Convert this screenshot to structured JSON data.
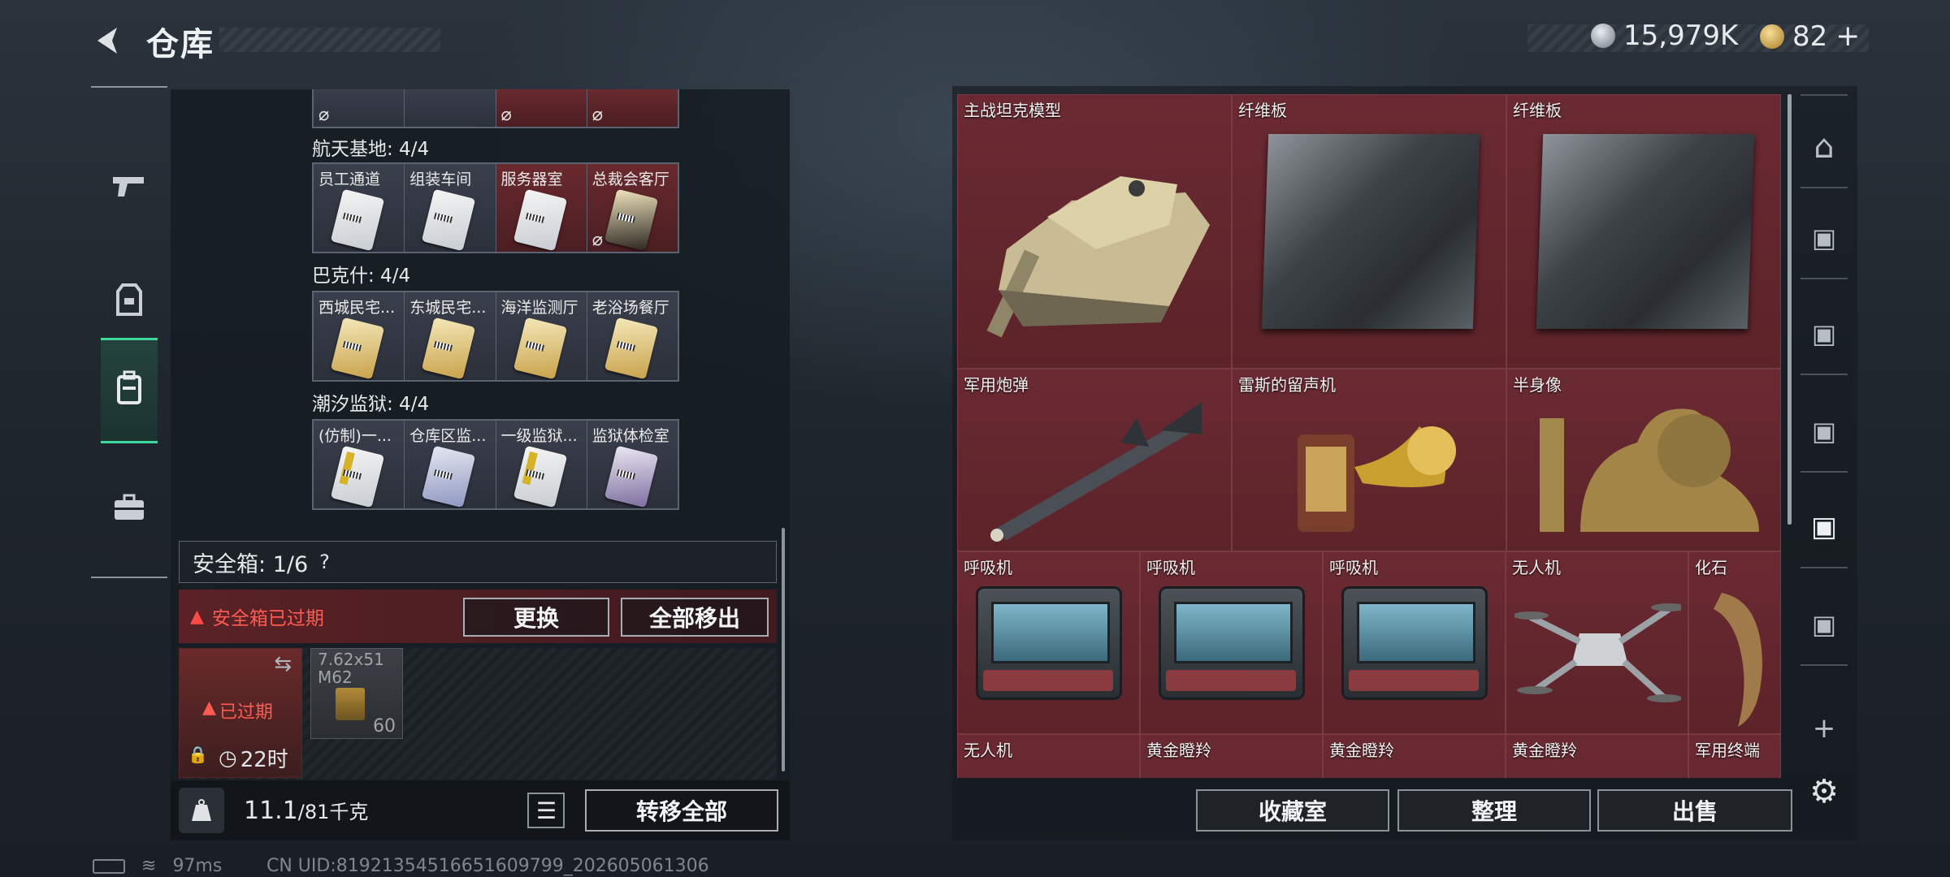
{
  "header": {
    "back_icon": "back-arrow-icon",
    "title": "仓库",
    "currency1_value": "15,979K",
    "currency2_value": "82",
    "currency2_add": "+"
  },
  "left_nav": [
    {
      "icon": "gun-icon"
    },
    {
      "icon": "armor-icon"
    },
    {
      "icon": "backpack-icon",
      "active": true
    },
    {
      "icon": "briefcase-icon"
    }
  ],
  "keycard_groups": [
    {
      "title": "航天基地: 4/4",
      "cards": [
        {
          "label": "员工通道",
          "style": "",
          "bg": ""
        },
        {
          "label": "组装车间",
          "style": "",
          "bg": ""
        },
        {
          "label": "服务器室",
          "style": "",
          "bg": "red"
        },
        {
          "label": "总裁会客厅",
          "style": "dark",
          "bg": "red"
        }
      ]
    },
    {
      "title": "巴克什: 4/4",
      "cards": [
        {
          "label": "西城民宅...",
          "style": "gold",
          "bg": ""
        },
        {
          "label": "东城民宅...",
          "style": "gold",
          "bg": ""
        },
        {
          "label": "海洋监测厅",
          "style": "gold",
          "bg": ""
        },
        {
          "label": "老浴场餐厅",
          "style": "gold",
          "bg": ""
        }
      ]
    },
    {
      "title": "潮汐监狱: 4/4",
      "cards": [
        {
          "label": "(仿制)一...",
          "style": "yellow",
          "bg": ""
        },
        {
          "label": "仓库区监...",
          "style": "blue",
          "bg": ""
        },
        {
          "label": "一级监狱...",
          "style": "yellow",
          "bg": ""
        },
        {
          "label": "监狱体检室",
          "style": "purple",
          "bg": ""
        }
      ]
    }
  ],
  "safe_box": {
    "label": "安全箱:",
    "count": "1/6",
    "help": "?",
    "expired_message": "安全箱已过期",
    "replace_button": "更换",
    "remove_all_button": "全部移出",
    "item_expired": "已过期",
    "item_timer": "22时",
    "ammo_name_line1": "7.62x51",
    "ammo_name_line2": "M62",
    "ammo_count": "60"
  },
  "weight": {
    "current": "11.1",
    "max": "/81千克",
    "transfer_all_button": "转移全部"
  },
  "items": [
    {
      "label": "主战坦克模型"
    },
    {
      "label": "纤维板"
    },
    {
      "label": "纤维板"
    },
    {
      "label": "军用炮弹"
    },
    {
      "label": "雷斯的留声机"
    },
    {
      "label": "半身像"
    },
    {
      "label": "呼吸机"
    },
    {
      "label": "呼吸机"
    },
    {
      "label": "呼吸机"
    },
    {
      "label": "无人机"
    },
    {
      "label": "化石"
    },
    {
      "label": "无人机"
    },
    {
      "label": "黄金瞪羚"
    },
    {
      "label": "黄金瞪羚"
    },
    {
      "label": "黄金瞪羚"
    },
    {
      "label": "军用终端"
    }
  ],
  "bottom_buttons": {
    "collection": "收藏室",
    "organize": "整理",
    "sell": "出售"
  },
  "status_bar": {
    "ping": "97ms",
    "uid": "CN UID:8192135451665160979​9_202605061306"
  },
  "colors": {
    "accent_green": "#3fd79a",
    "warning_red": "#ff5b52",
    "item_bg": "#6b2a33"
  }
}
